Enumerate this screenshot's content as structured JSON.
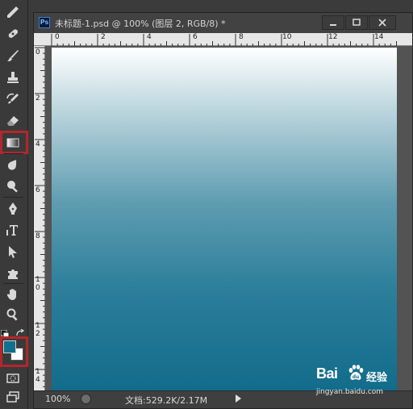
{
  "app": {
    "badge": "Ps"
  },
  "document": {
    "title": "未标题-1.psd @ 100% (图层 2, RGB/8) *",
    "zoom": "100%",
    "doc_info": "文档:529.2K/2.17M"
  },
  "rulers": {
    "horizontal": [
      "0",
      "2",
      "4",
      "6",
      "8",
      "10",
      "12",
      "14"
    ],
    "vertical": [
      [
        "0"
      ],
      [
        "2"
      ],
      [
        "4"
      ],
      [
        "6"
      ],
      [
        "8"
      ],
      [
        "1",
        "0"
      ],
      [
        "1",
        "2"
      ],
      [
        "1",
        "4"
      ]
    ]
  },
  "tools": [
    "eyedropper-tool",
    "spot-healing-brush-tool",
    "brush-tool",
    "clone-stamp-tool",
    "history-brush-tool",
    "eraser-tool",
    "gradient-tool",
    "blur-tool",
    "dodge-tool",
    "pen-tool",
    "type-tool",
    "path-selection-tool",
    "custom-shape-tool",
    "hand-tool",
    "zoom-tool",
    "quick-mask-tool",
    "screen-mode-tool"
  ],
  "colors": {
    "foreground": "#136f8e",
    "background": "#ffffff",
    "highlight": "#b3262b",
    "gradient_end": "#126c8b"
  },
  "selected_tool": "gradient-tool",
  "watermark": {
    "brand": "Bai",
    "brand_suffix": "经验",
    "url": "jingyan.baidu.com"
  }
}
